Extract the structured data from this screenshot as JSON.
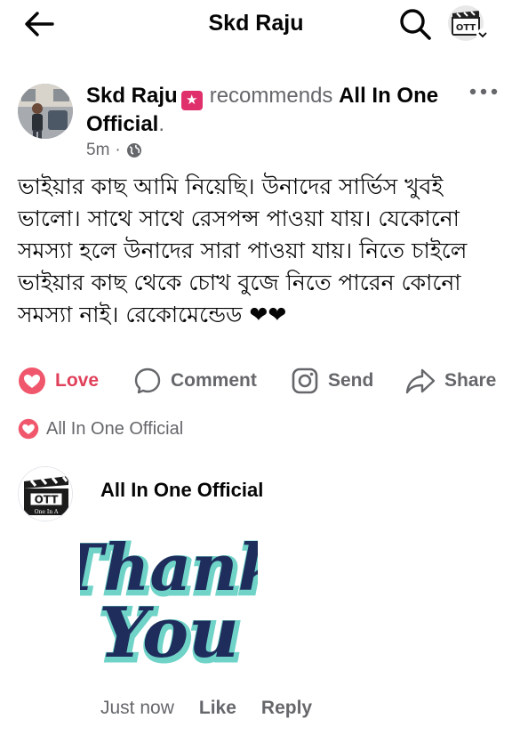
{
  "header": {
    "title": "Skd Raju",
    "profile_icon_text": "OTT"
  },
  "post": {
    "author": "Skd Raju",
    "badge_symbol": "★",
    "verb": "recommends",
    "page_name": "All In One Official",
    "period": ".",
    "time": "5m",
    "meta_separator": "·",
    "privacy_icon": "globe-icon",
    "body": "ভাইয়ার কাছ আমি নিয়েছি। উনাদের সার্ভিস খুবই ভালো। সাথে সাথে রেসপন্স পাওয়া যায়। যেকোনো সমস্যা হলে উনাদের সারা পাওয়া যায়। নিতে চাইলে ভাইয়ার কাছ থেকে চোখ বুজে নিতে পারেন কোনো সমস্যা নাই। রেকোমেন্ডেড ❤❤"
  },
  "actions": {
    "love": "Love",
    "comment": "Comment",
    "send": "Send",
    "share": "Share"
  },
  "reaction_summary": {
    "name": "All In One Official"
  },
  "comment": {
    "author": "All In One Official",
    "avatar_text": "OTT",
    "avatar_subtext": "One In A",
    "sticker_line1": "Thank",
    "sticker_line2": "You",
    "time": "Just now",
    "like": "Like",
    "reply": "Reply"
  },
  "colors": {
    "love_red": "#e0405a",
    "badge_pink": "#e0306b",
    "secondary_text": "#65676b",
    "sticker_navy": "#1f2d5c",
    "sticker_teal": "#6fd3c8"
  }
}
